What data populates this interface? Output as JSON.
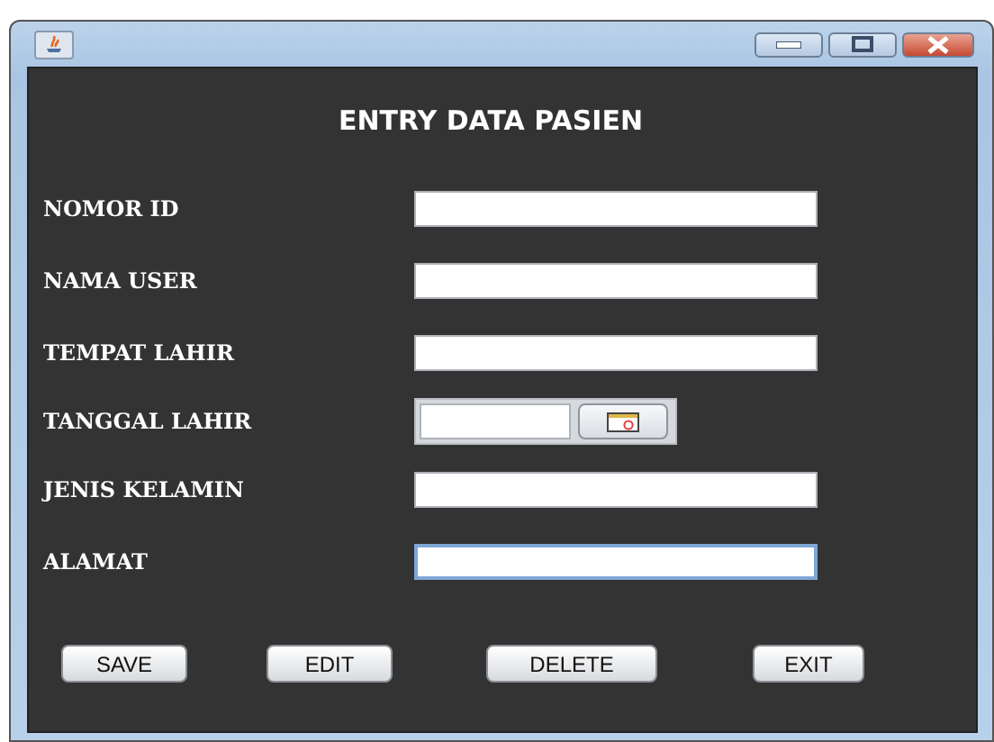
{
  "window": {
    "title": "ENTRY DATA PASIEN"
  },
  "fields": [
    {
      "label": "NOMOR ID",
      "kind": "text",
      "focused": false
    },
    {
      "label": "NAMA USER",
      "kind": "text",
      "focused": false
    },
    {
      "label": "TEMPAT LAHIR",
      "kind": "text",
      "focused": false
    },
    {
      "label": "TANGGAL LAHIR",
      "kind": "date",
      "focused": false
    },
    {
      "label": "JENIS KELAMIN",
      "kind": "text",
      "focused": false
    },
    {
      "label": "ALAMAT",
      "kind": "text",
      "focused": true
    }
  ],
  "buttons": [
    "SAVE",
    "EDIT",
    "DELETE",
    "EXIT"
  ]
}
